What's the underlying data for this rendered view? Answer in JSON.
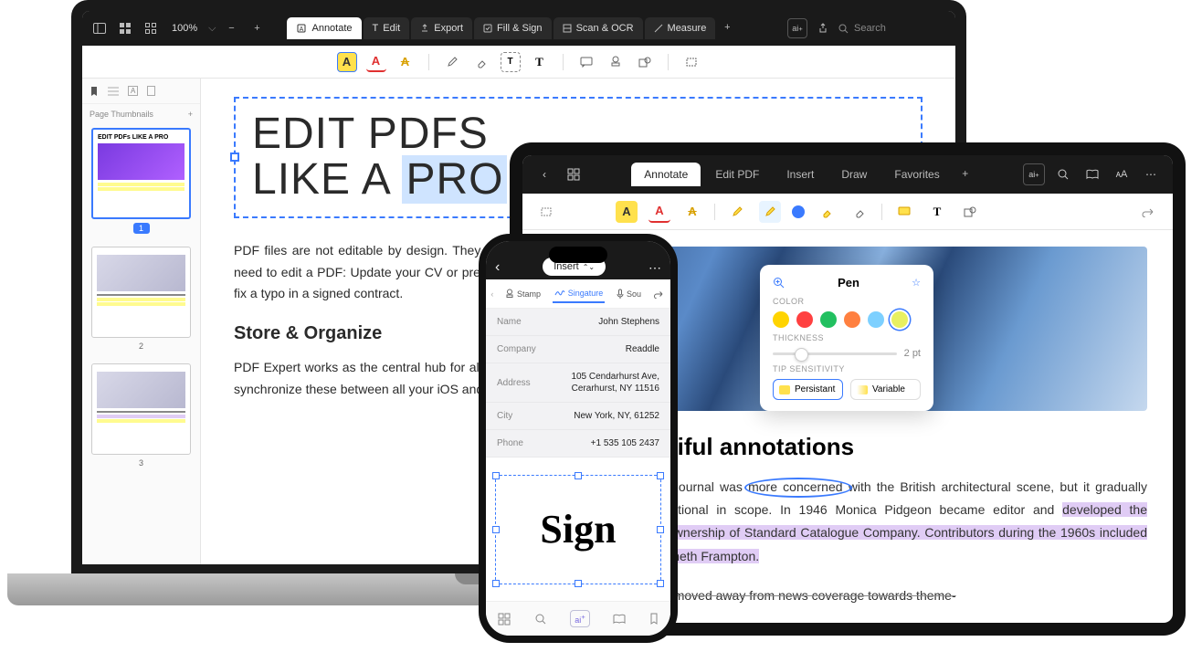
{
  "mac": {
    "zoom": "100%",
    "tabs": [
      {
        "label": "Annotate",
        "icon": "annotate-icon"
      },
      {
        "label": "Edit",
        "icon": "edit-icon"
      },
      {
        "label": "Export",
        "icon": "export-icon"
      },
      {
        "label": "Fill & Sign",
        "icon": "fill-sign-icon"
      },
      {
        "label": "Scan & OCR",
        "icon": "scan-icon"
      },
      {
        "label": "Measure",
        "icon": "measure-icon"
      }
    ],
    "search_placeholder": "Search",
    "sidebar_title": "Page Thumbnails",
    "thumb_label": "EDIT PDFs LIKE A PRO",
    "doc": {
      "title_a": "EDIT PDFS",
      "title_b": "LIKE A ",
      "title_c": "PRO",
      "p1": "PDF files are not editable by design. They are the digital equivalent of paper. But there are many situations when you need to edit a PDF: Update your CV or presentation for a client, change the address and company logo in an invoice, or fix a typo in a signed contract.",
      "h2": "Store & Organize",
      "p2": "PDF Expert works as the central hub for all your documents. You can save and organize PDF files in the app and easily synchronize these  between all your iOS and Mac"
    }
  },
  "ipad": {
    "tabs": [
      "Annotate",
      "Edit PDF",
      "Insert",
      "Draw",
      "Favorites"
    ],
    "pen": {
      "title": "Pen",
      "label_color": "COLOR",
      "label_thick": "THICKNESS",
      "thick_val": "2 pt",
      "label_tip": "TIP SENSITIVITY",
      "tip_a": "Persistant",
      "tip_b": "Variable",
      "colors": [
        "#ffd400",
        "#ff4040",
        "#22c060",
        "#ff8040",
        "#7dd0ff",
        "#e8f060"
      ]
    },
    "h2": "Make beautiful annotations",
    "p1_a": "In its early days, the journal was ",
    "p1_circ": "more concerned ",
    "p1_b": "with the British architectural scene, but it gradually became more international in scope. In 1946 Monica Pidgeon became editor and ",
    "p1_hl": "developed the magazine under the ownership of Standard Catalogue Company. Contributors during the 1960s included Theo Crosby and Kenneth Frampton.",
    "p2": "Over time, the journal moved away from news coverage towards theme-"
  },
  "phone": {
    "insert": "Insert",
    "tools": [
      "Stamp",
      "Singature",
      "Sou"
    ],
    "fields": [
      {
        "label": "Name",
        "value": "John Stephens"
      },
      {
        "label": "Company",
        "value": "Readdle"
      },
      {
        "label": "Address",
        "value": "105 Cendarhurst Ave,\nCerarhurst, NY 11516"
      },
      {
        "label": "City",
        "value": "New York, NY, 61252"
      },
      {
        "label": "Phone",
        "value": "+1 535 105 2437"
      }
    ],
    "signature": "Sign"
  }
}
